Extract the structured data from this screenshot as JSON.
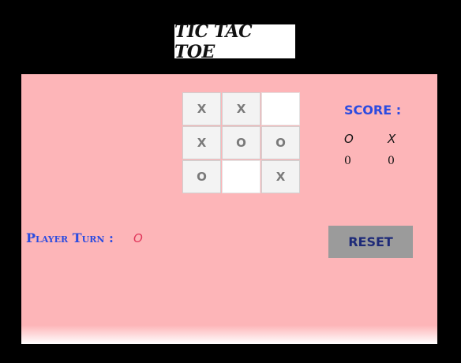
{
  "header": {
    "title": "TIC TAC TOE"
  },
  "board": {
    "cells": [
      "X",
      "X",
      "",
      "X",
      "O",
      "O",
      "O",
      "",
      "X"
    ]
  },
  "score": {
    "title": "SCORE :",
    "players": [
      {
        "symbol": "O",
        "value": "0"
      },
      {
        "symbol": "X",
        "value": "0"
      }
    ]
  },
  "turn": {
    "label": "Player Turn :",
    "current": "O"
  },
  "controls": {
    "reset_label": "RESET"
  },
  "colors": {
    "panel_bg": "#fdb5b8",
    "accent_blue": "#2b4be0",
    "turn_red": "#e0365a",
    "button_bg": "#9b9b9b",
    "button_text": "#1e2a78"
  }
}
